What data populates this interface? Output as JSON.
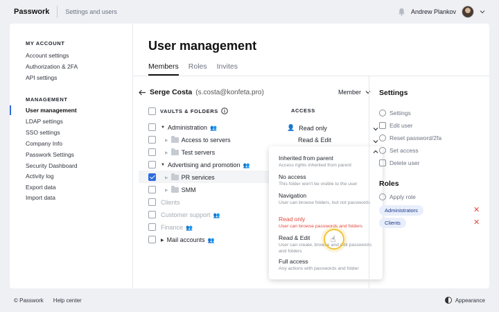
{
  "header": {
    "logo": "Passwork",
    "breadcrumb": "Settings and users",
    "user_name": "Andrew Plankov"
  },
  "sidebar": {
    "sections": [
      {
        "title": "MY ACCOUNT",
        "items": [
          "Account settings",
          "Authorization & 2FA",
          "API settings"
        ]
      },
      {
        "title": "MANAGEMENT",
        "items": [
          "User management",
          "LDAP settings",
          "SSO settings",
          "Company Info",
          "Passwork Settings",
          "Security Dashboard",
          "Activity log",
          "Export data",
          "Import data"
        ]
      }
    ],
    "active_item": "User management"
  },
  "main": {
    "title": "User management",
    "tabs": [
      "Members",
      "Roles",
      "Invites"
    ],
    "active_tab": "Members",
    "user": {
      "name": "Serge Costa",
      "email": "(s.costa@konfeta.pro)"
    },
    "role": "Member",
    "columns": {
      "vaults": "VAULTS & FOLDERS",
      "access": "ACCESS"
    },
    "rows": [
      {
        "label": "Administration",
        "level": 0,
        "group": true,
        "access": "Read only",
        "checked": false,
        "muted": false
      },
      {
        "label": "Access to servers",
        "level": 1,
        "group": false,
        "access": "Read & Edit",
        "checked": false,
        "muted": false
      },
      {
        "label": "Test servers",
        "level": 1,
        "group": false,
        "access": "",
        "checked": false,
        "muted": false
      },
      {
        "label": "Advertising and promotion",
        "level": 0,
        "group": true,
        "access": "",
        "checked": false,
        "muted": false
      },
      {
        "label": "PR services",
        "level": 1,
        "group": false,
        "access": "",
        "checked": true,
        "muted": false
      },
      {
        "label": "SMM",
        "level": 1,
        "group": false,
        "access": "",
        "checked": false,
        "muted": false
      },
      {
        "label": "Clients",
        "level": 0,
        "group": false,
        "access": "",
        "checked": false,
        "muted": true
      },
      {
        "label": "Customer support",
        "level": 0,
        "group": true,
        "access": "",
        "checked": false,
        "muted": true
      },
      {
        "label": "Finance",
        "level": 0,
        "group": true,
        "access": "",
        "checked": false,
        "muted": true
      },
      {
        "label": "Mail accounts",
        "level": 0,
        "group": true,
        "access": "",
        "checked": false,
        "muted": false
      }
    ],
    "access_options": [
      {
        "title": "Inherited from parent",
        "desc": "Access rights inherited from parent"
      },
      {
        "title": "No access",
        "desc": "This folder won't be visible to the user"
      },
      {
        "title": "Navigation",
        "desc": "User can browse folders, but not passwords"
      },
      {
        "title": "Read only",
        "desc": "User can browse passwords and folders",
        "selected": true
      },
      {
        "title": "Read & Edit",
        "desc": "User can create, browse and edit passwords and folders"
      },
      {
        "title": "Full access",
        "desc": "Any actions with passwords and folder"
      }
    ]
  },
  "settings": {
    "title": "Settings",
    "items": [
      "Settings",
      "Edit user",
      "Reset password/2fa",
      "Set access",
      "Delete user"
    ],
    "roles_title": "Roles",
    "apply_role": "Apply role",
    "roles": [
      "Administrators",
      "Clients"
    ]
  },
  "footer": {
    "copyright": "© Passwork",
    "help": "Help center",
    "appearance": "Appearance"
  },
  "colors": {
    "accent": "#2d6cdf",
    "danger": "#e2483d",
    "highlight": "#f1c232"
  }
}
